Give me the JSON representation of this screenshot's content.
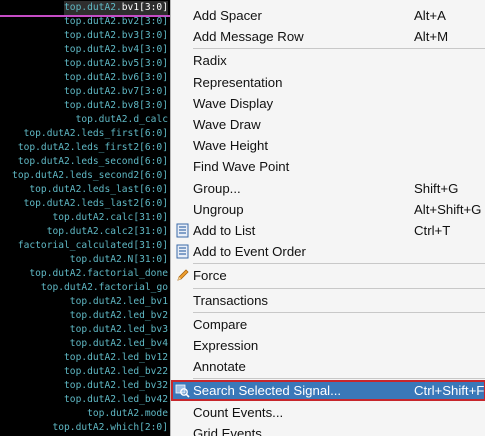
{
  "signals": [
    {
      "prefix": "top.dutA2.",
      "accent": "bv1[3:0]",
      "selected": true
    },
    {
      "prefix": "top.dutA2.bv2[3:0]"
    },
    {
      "prefix": "top.dutA2.bv3[3:0]"
    },
    {
      "prefix": "top.dutA2.bv4[3:0]"
    },
    {
      "prefix": "top.dutA2.bv5[3:0]"
    },
    {
      "prefix": "top.dutA2.bv6[3:0]"
    },
    {
      "prefix": "top.dutA2.bv7[3:0]"
    },
    {
      "prefix": "top.dutA2.bv8[3:0]"
    },
    {
      "prefix": "top.dutA2.d_calc"
    },
    {
      "prefix": "top.dutA2.leds_first[6:0]"
    },
    {
      "prefix": "top.dutA2.leds_first2[6:0]"
    },
    {
      "prefix": "top.dutA2.leds_second[6:0]"
    },
    {
      "prefix": "top.dutA2.leds_second2[6:0]"
    },
    {
      "prefix": "top.dutA2.leds_last[6:0]"
    },
    {
      "prefix": "top.dutA2.leds_last2[6:0]"
    },
    {
      "prefix": "top.dutA2.calc[31:0]"
    },
    {
      "prefix": "top.dutA2.calc2[31:0]"
    },
    {
      "prefix": "factorial_calculated[31:0]"
    },
    {
      "prefix": "top.dutA2.N[31:0]"
    },
    {
      "prefix": "top.dutA2.factorial_done"
    },
    {
      "prefix": "top.dutA2.factorial_go"
    },
    {
      "prefix": "top.dutA2.led_bv1"
    },
    {
      "prefix": "top.dutA2.led_bv2"
    },
    {
      "prefix": "top.dutA2.led_bv3"
    },
    {
      "prefix": "top.dutA2.led_bv4"
    },
    {
      "prefix": "top.dutA2.led_bv12"
    },
    {
      "prefix": "top.dutA2.led_bv22"
    },
    {
      "prefix": "top.dutA2.led_bv32"
    },
    {
      "prefix": "top.dutA2.led_bv42"
    },
    {
      "prefix": "top.dutA2.mode"
    },
    {
      "prefix": "top.dutA2.which[2:0]"
    }
  ],
  "menu": {
    "items": [
      {
        "label": "Add Spacer",
        "shortcut": "Alt+A",
        "icon": ""
      },
      {
        "label": "Add Message Row",
        "shortcut": "Alt+M",
        "icon": ""
      },
      {
        "separator": true
      },
      {
        "label": "Radix",
        "shortcut": "",
        "icon": ""
      },
      {
        "label": "Representation",
        "shortcut": "",
        "icon": ""
      },
      {
        "label": "Wave Display",
        "shortcut": "",
        "icon": ""
      },
      {
        "label": "Wave Draw",
        "shortcut": "",
        "icon": ""
      },
      {
        "label": "Wave Height",
        "shortcut": "",
        "icon": ""
      },
      {
        "label": "Find Wave Point",
        "shortcut": "",
        "icon": ""
      },
      {
        "label": "Group...",
        "shortcut": "Shift+G",
        "icon": ""
      },
      {
        "label": "Ungroup",
        "shortcut": "Alt+Shift+G",
        "icon": ""
      },
      {
        "label": "Add to List",
        "shortcut": "Ctrl+T",
        "icon": "list-icon"
      },
      {
        "label": "Add to Event Order",
        "shortcut": "",
        "icon": "list-icon"
      },
      {
        "separator": true
      },
      {
        "label": "Force",
        "shortcut": "",
        "icon": "pencil-icon"
      },
      {
        "separator": true
      },
      {
        "label": "Transactions",
        "shortcut": "",
        "icon": ""
      },
      {
        "separator": true
      },
      {
        "label": "Compare",
        "shortcut": "",
        "icon": ""
      },
      {
        "label": "Expression",
        "shortcut": "",
        "icon": ""
      },
      {
        "label": "Annotate",
        "shortcut": "",
        "icon": ""
      },
      {
        "separator": true
      },
      {
        "label": "Search Selected Signal...",
        "shortcut": "Ctrl+Shift+F",
        "icon": "search-signal-icon",
        "highlighted": true
      },
      {
        "label": "Count Events...",
        "shortcut": "",
        "icon": ""
      },
      {
        "label": "Grid Events...",
        "shortcut": "",
        "icon": ""
      }
    ]
  },
  "colors": {
    "signal_text": "#5fb8c4",
    "selection_bar": "#c54cc5",
    "menu_highlight": "#3a78b9",
    "highlight_border": "#c7262c"
  }
}
